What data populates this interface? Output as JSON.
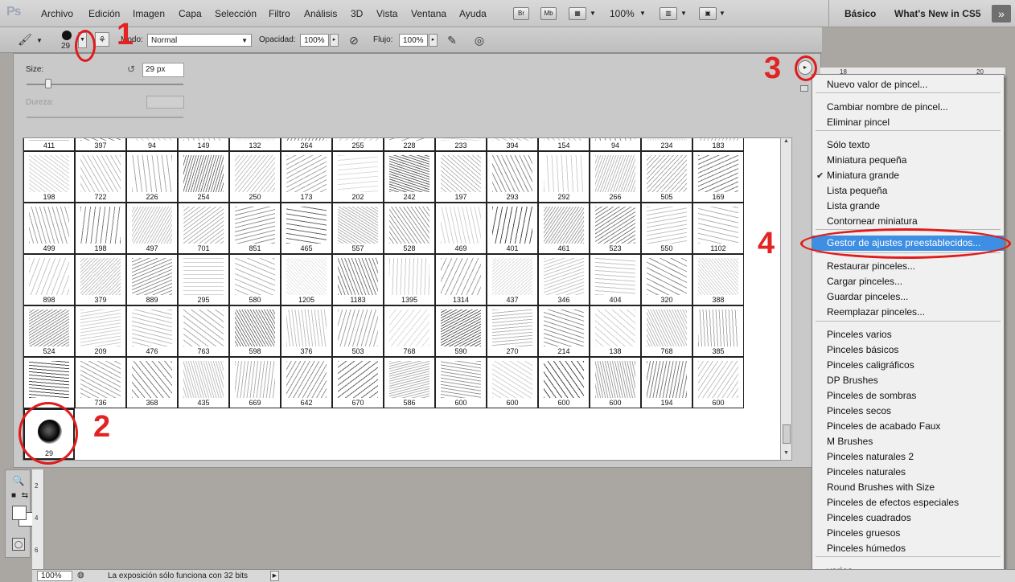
{
  "app_logo": "Ps",
  "menubar": {
    "items": [
      "Archivo",
      "Edición",
      "Imagen",
      "Capa",
      "Selección",
      "Filtro",
      "Análisis",
      "3D",
      "Vista",
      "Ventana",
      "Ayuda"
    ],
    "bridge": "Br",
    "mini_bridge": "Mb",
    "zoom": "100%",
    "workspaces": [
      "Básico",
      "What's New in CS5"
    ]
  },
  "options": {
    "brush_size": "29",
    "mode_label": "Modo:",
    "mode_value": "Normal",
    "opacity_label": "Opacidad:",
    "opacity_value": "100%",
    "flow_label": "Flujo:",
    "flow_value": "100%"
  },
  "picker": {
    "size_label": "Size:",
    "size_value": "29 px",
    "hardness_label": "Dureza:",
    "size_slider_fraction": 0.12
  },
  "brushes": {
    "row0": [
      "411",
      "397",
      "94",
      "149",
      "132",
      "264",
      "255",
      "228",
      "233",
      "394",
      "154",
      "94",
      "234",
      "183"
    ],
    "row1": [
      "198",
      "722",
      "226",
      "254",
      "250",
      "173",
      "202",
      "242",
      "197",
      "293",
      "292",
      "266",
      "505",
      "169"
    ],
    "row2": [
      "499",
      "198",
      "497",
      "701",
      "851",
      "465",
      "557",
      "528",
      "469",
      "401",
      "461",
      "523",
      "550",
      "1102"
    ],
    "row3": [
      "898",
      "379",
      "889",
      "295",
      "580",
      "1205",
      "1183",
      "1395",
      "1314",
      "437",
      "346",
      "404",
      "320",
      "388"
    ],
    "row4": [
      "524",
      "209",
      "476",
      "763",
      "598",
      "376",
      "503",
      "768",
      "590",
      "270",
      "214",
      "138",
      "768",
      "385"
    ],
    "row5": [
      "",
      "736",
      "368",
      "435",
      "669",
      "642",
      "670",
      "586",
      "600",
      "600",
      "600",
      "600",
      "194",
      "600"
    ],
    "row6": [
      "29"
    ]
  },
  "flymenu": {
    "items": [
      "Nuevo valor de pincel...",
      "Cambiar nombre de pincel...",
      "Eliminar pincel",
      "Sólo texto",
      "Miniatura pequeña",
      "Miniatura grande",
      "Lista pequeña",
      "Lista grande",
      "Contornear miniatura",
      "Gestor de ajustes preestablecidos...",
      "Restaurar pinceles...",
      "Cargar pinceles...",
      "Guardar pinceles...",
      "Reemplazar pinceles...",
      "Pinceles varios",
      "Pinceles básicos",
      "Pinceles caligráficos",
      "DP Brushes",
      "Pinceles de sombras",
      "Pinceles secos",
      "Pinceles de acabado Faux",
      "M Brushes",
      "Pinceles naturales 2",
      "Pinceles naturales",
      "Round Brushes with Size",
      "Pinceles de efectos especiales",
      "Pinceles cuadrados",
      "Pinceles gruesos",
      "Pinceles húmedos",
      "varios"
    ],
    "checked": "Miniatura grande",
    "highlighted": "Gestor de ajustes preestablecidos..."
  },
  "ruler": {
    "h_marks": [
      "18",
      "20"
    ],
    "v_marks": [
      "2",
      "4",
      "6"
    ]
  },
  "statusbar": {
    "zoom": "100%",
    "message": "La exposición sólo funciona con 32 bits"
  },
  "annotations": [
    "1",
    "2",
    "3",
    "4"
  ]
}
